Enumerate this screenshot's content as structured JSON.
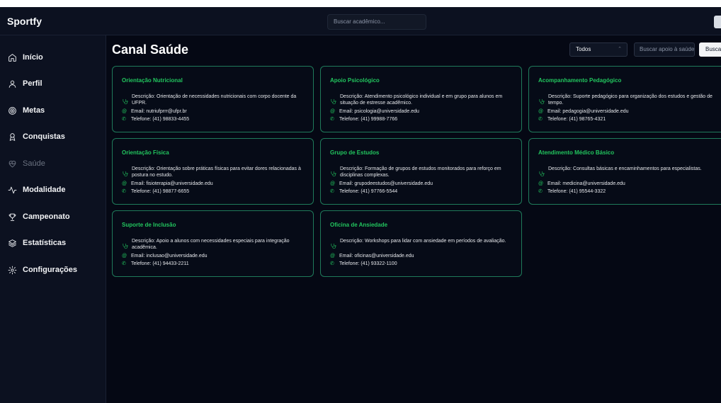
{
  "app": {
    "brand": "Sportfy"
  },
  "topbar": {
    "search_placeholder": "Buscar acadêmico..."
  },
  "sidebar": {
    "items": [
      {
        "label": "Início",
        "icon": "home-icon"
      },
      {
        "label": "Perfil",
        "icon": "user-icon"
      },
      {
        "label": "Metas",
        "icon": "target-icon"
      },
      {
        "label": "Conquistas",
        "icon": "medal-icon"
      },
      {
        "label": "Saúde",
        "icon": "heart-icon",
        "active": true
      },
      {
        "label": "Modalidade",
        "icon": "activity-icon"
      },
      {
        "label": "Campeonato",
        "icon": "trophy-icon"
      },
      {
        "label": "Estatísticas",
        "icon": "layers-icon"
      },
      {
        "label": "Configurações",
        "icon": "gear-icon"
      }
    ]
  },
  "main": {
    "title": "Canal Saúde",
    "filter_value": "Todos",
    "filter_caret": "⌃",
    "search_placeholder": "Buscar apoio à saúde",
    "search_button": "Buscar"
  },
  "cards": [
    {
      "title": "Orientação Nutricional",
      "description": "Descrição: Orientação de necessidades nutricionais com corpo docente da UFPR.",
      "email": "Email: nutriufprrr@ufpr.br",
      "phone": "Telefone: (41) 98833-4455"
    },
    {
      "title": "Apoio Psicológico",
      "description": "Descrição: Atendimento psicológico individual e em grupo para alunos em situação de estresse acadêmico.",
      "email": "Email: psicologia@universidade.edu",
      "phone": "Telefone: (41) 99988-7766"
    },
    {
      "title": "Acompanhamento Pedagógico",
      "description": "Descrição: Suporte pedagógico para organização dos estudos e gestão de tempo.",
      "email": "Email: pedagogia@universidade.edu",
      "phone": "Telefone: (41) 98765-4321"
    },
    {
      "title": "Orientação Física",
      "description": "Descrição: Orientação sobre práticas físicas para evitar dores relacionadas à postura no estudo.",
      "email": "Email: fisioterapia@universidade.edu",
      "phone": "Telefone: (41) 98877-6655"
    },
    {
      "title": "Grupo de Estudos",
      "description": "Descrição: Formação de grupos de estudos monitorados para reforço em disciplinas complexas.",
      "email": "Email: grupodeestudos@universidade.edu",
      "phone": "Telefone: (41) 97766-5544"
    },
    {
      "title": "Atendimento Médico Básico",
      "description": "Descrição: Consultas básicas e encaminhamentos para especialistas.",
      "email": "Email: medicina@universidade.edu",
      "phone": "Telefone: (41) 95544-3322"
    },
    {
      "title": "Suporte de Inclusão",
      "description": "Descrição: Apoio a alunos com necessidades especiais para integração acadêmica.",
      "email": "Email: inclusao@universidade.edu",
      "phone": "Telefone: (41) 94433-2211"
    },
    {
      "title": "Oficina de Ansiedade",
      "description": "Descrição: Workshops para lidar com ansiedade em períodos de avaliação.",
      "email": "Email: oficinas@universidade.edu",
      "phone": "Telefone: (41) 93322-1100"
    }
  ],
  "colors": {
    "accent": "#22c55e",
    "border": "#1f7a5a",
    "background": "#050814",
    "sidebar": "#0c1120"
  }
}
